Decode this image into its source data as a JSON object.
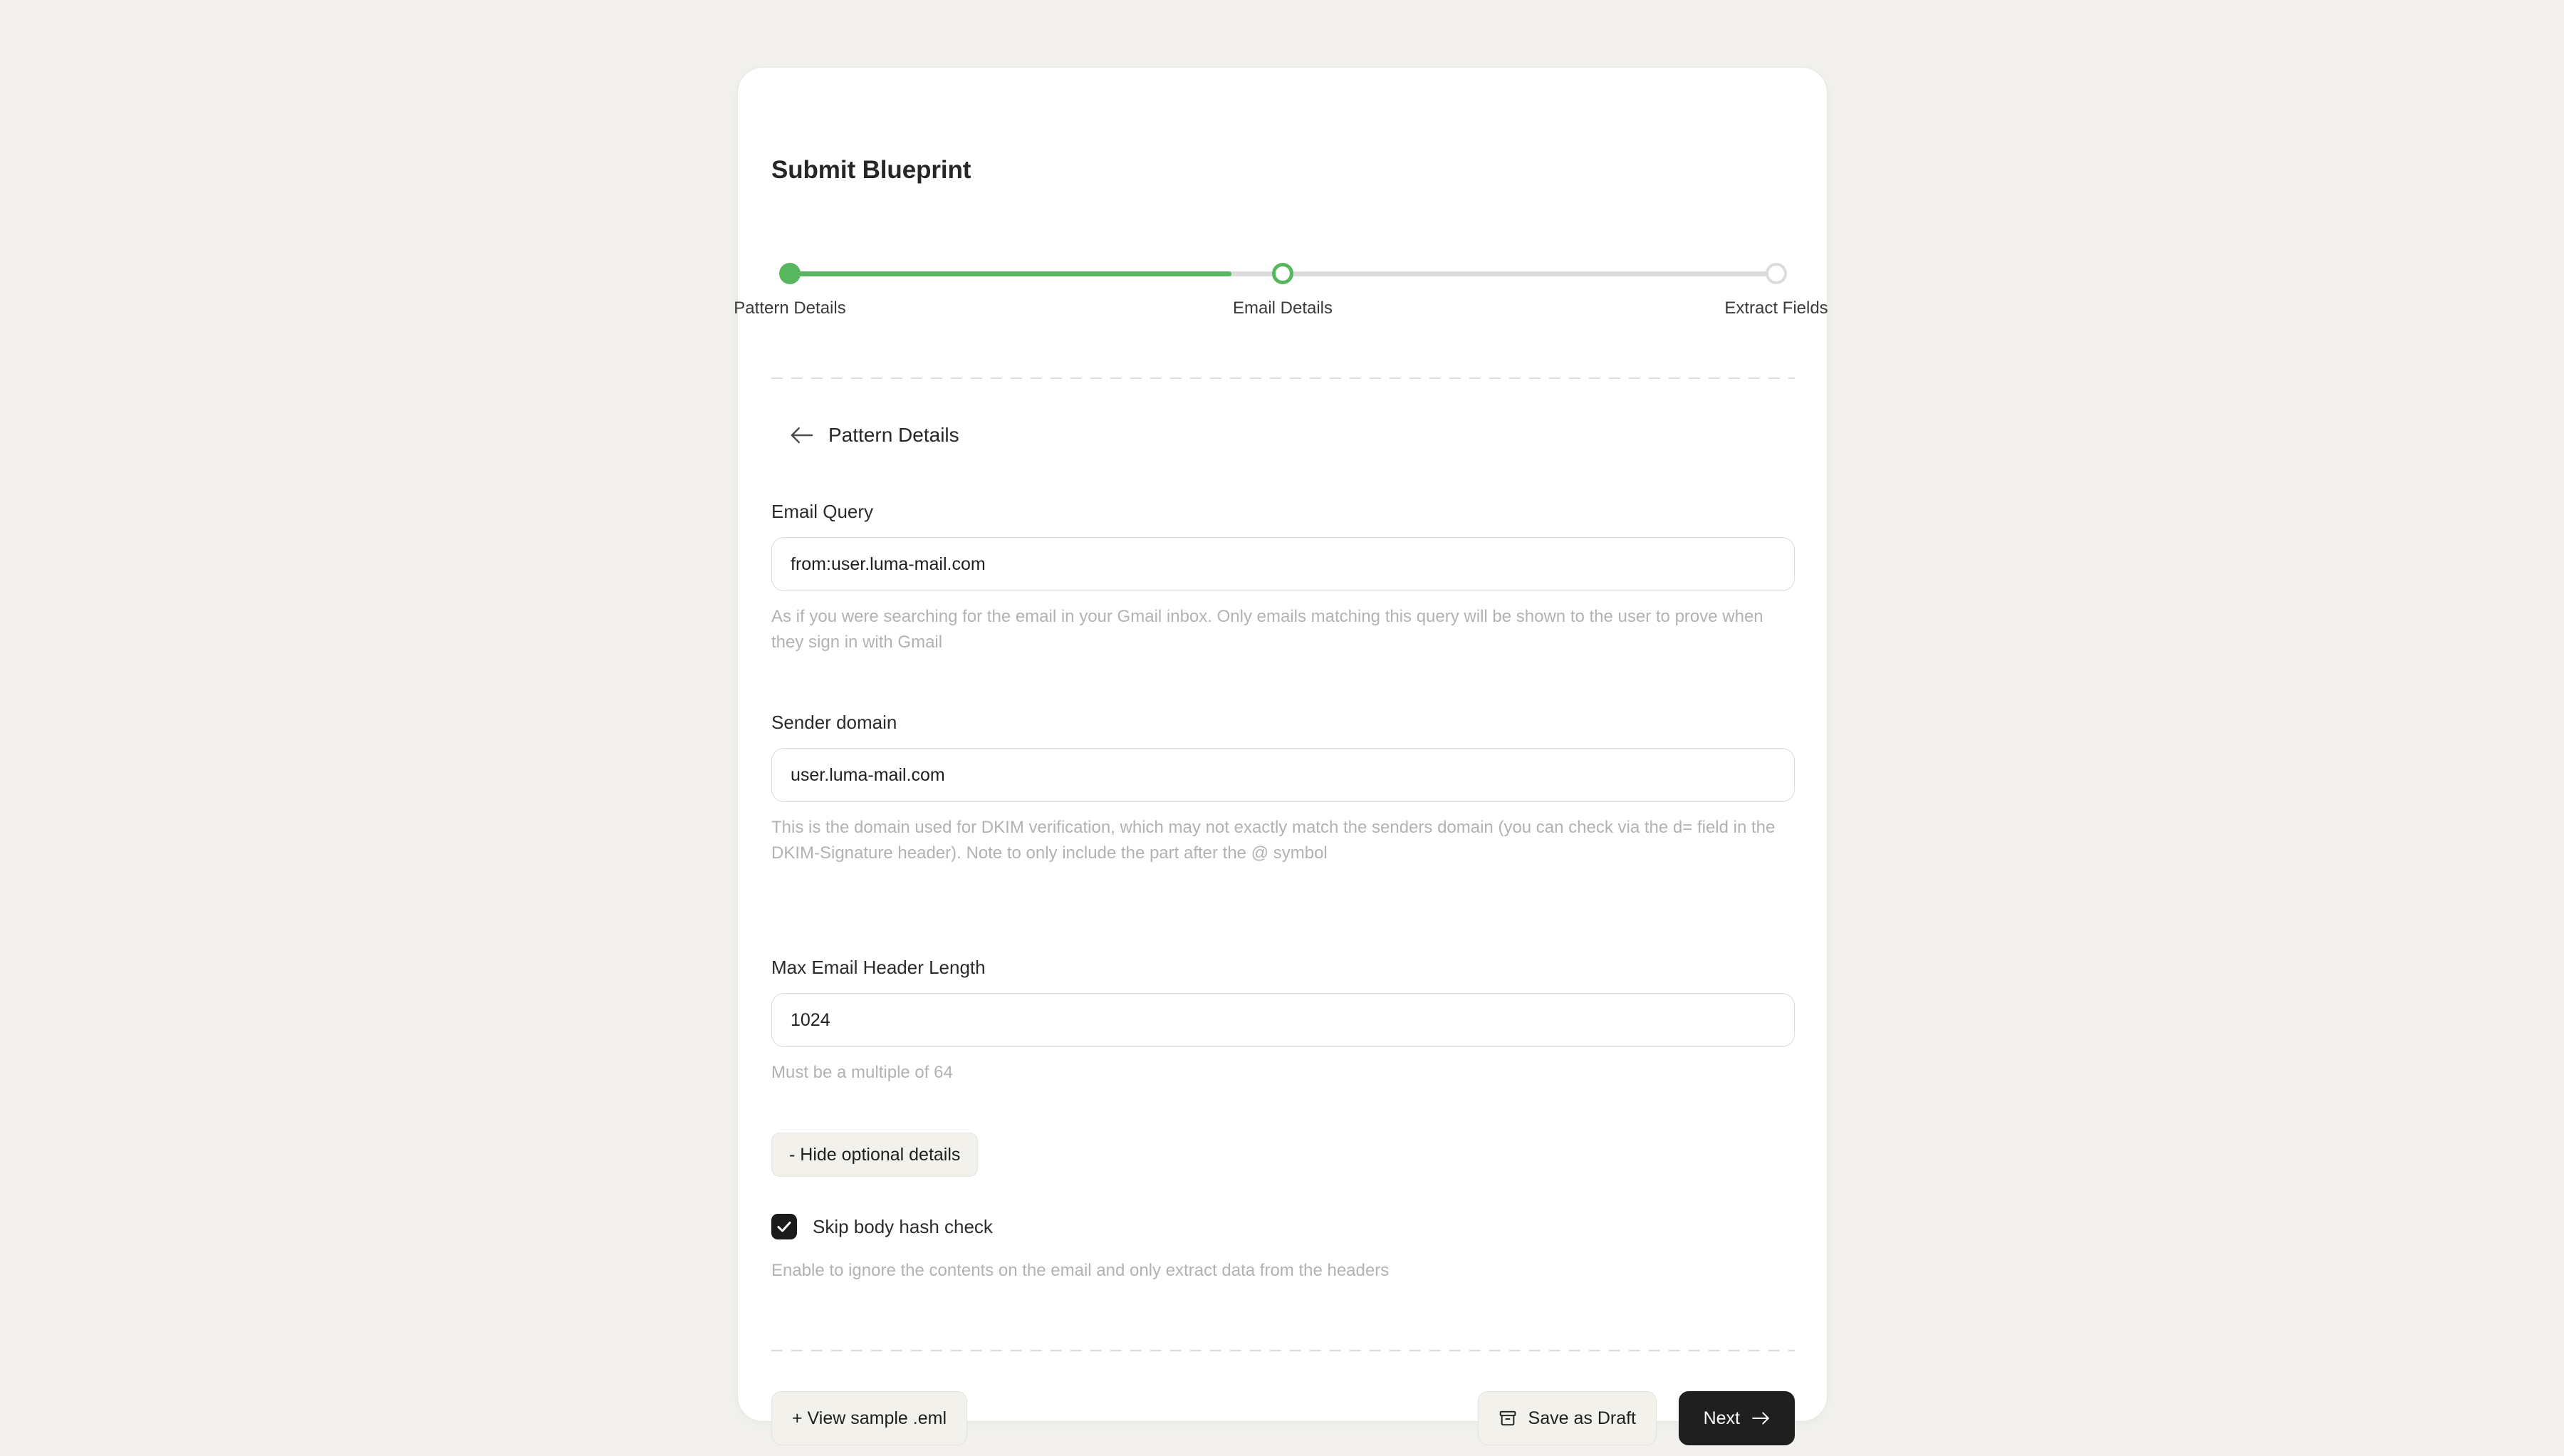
{
  "card": {
    "title": "Submit Blueprint"
  },
  "stepper": {
    "steps": [
      {
        "label": "Pattern Details",
        "state": "done"
      },
      {
        "label": "Email Details",
        "state": "current"
      },
      {
        "label": "Extract Fields",
        "state": "todo"
      }
    ],
    "active_color": "#57b75e",
    "inactive_color": "#dcdcdc"
  },
  "section": {
    "back_icon": "arrow-left-icon",
    "title": "Pattern Details"
  },
  "fields": {
    "email_query": {
      "label": "Email Query",
      "value": "from:user.luma-mail.com",
      "placeholder": "from:user.luma-mail.com",
      "help": "As if you were searching for the email in your Gmail inbox. Only emails matching this query will be shown to the user to prove when they sign in with Gmail"
    },
    "sender_domain": {
      "label": "Sender domain",
      "value": "user.luma-mail.com",
      "placeholder": "user.luma-mail.com",
      "help": "This is the domain used for DKIM verification, which may not exactly match the senders domain (you can check via the d= field in the DKIM-Signature header). Note to only include the part after the @ symbol"
    },
    "max_header_length": {
      "label": "Max Email Header Length",
      "value": "1024",
      "placeholder": "1024",
      "help": "Must be a multiple of 64"
    }
  },
  "optional": {
    "toggle_label": "- Hide optional details",
    "skip_body_hash": {
      "label": "Skip body hash check",
      "checked": true,
      "help": "Enable to ignore the contents on the email and only extract data from the headers"
    }
  },
  "footer": {
    "view_sample_label": "+ View sample .eml",
    "save_draft_label": "Save as Draft",
    "save_draft_icon": "archive-box-icon",
    "next_label": "Next",
    "next_icon": "arrow-right-icon"
  },
  "colors": {
    "page_background": "#f2f1ed",
    "card_background": "#ffffff",
    "accent_green": "#57b75e",
    "primary_button": "#1f1f1f",
    "muted_text": "#b2b2b0"
  }
}
